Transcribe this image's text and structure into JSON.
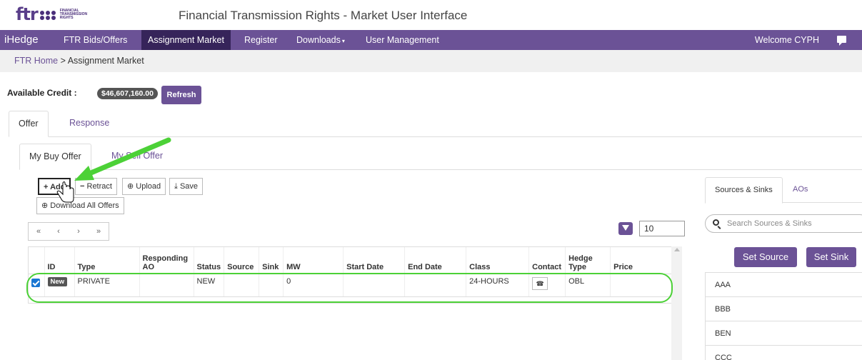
{
  "brand": {
    "logo_text": "ftr",
    "logo_sub": "FINANCIAL TRANSMISSION RIGHTS"
  },
  "app_title": "Financial Transmission Rights - Market User Interface",
  "nav": {
    "brand": "iHedge",
    "items": [
      "FTR Bids/Offers",
      "Assignment Market",
      "Register",
      "Downloads",
      "User Management"
    ],
    "welcome": "Welcome CYPH"
  },
  "breadcrumb": {
    "home": "FTR Home",
    "separator": " > ",
    "current": "Assignment Market"
  },
  "credit": {
    "label": "Available Credit :",
    "value": "$46,607,160.00",
    "refresh": "Refresh"
  },
  "tabs": [
    "Offer",
    "Response"
  ],
  "subtabs": [
    "My Buy Offer",
    "My Sell Offer"
  ],
  "toolbar": {
    "add": "Add",
    "retract": "Retract",
    "upload": "Upload",
    "save": "Save",
    "download_all": "Download All Offers"
  },
  "pager": {
    "first": "«",
    "prev": "‹",
    "next": "›",
    "last": "»"
  },
  "page_size": "10",
  "table": {
    "headers": [
      "ID",
      "Type",
      "Responding AO",
      "Status",
      "Source",
      "Sink",
      "MW",
      "Start Date",
      "End Date",
      "Class",
      "Contact",
      "Hedge Type",
      "Price"
    ],
    "rows": [
      {
        "id": "New",
        "type": "PRIVATE",
        "responding_ao": "",
        "status": "NEW",
        "source": "",
        "sink": "",
        "mw": "0",
        "start": "",
        "end": "",
        "class": "24-HOURS",
        "hedge_type": "OBL",
        "price": ""
      }
    ]
  },
  "right_panel": {
    "tabs": [
      "Sources & Sinks",
      "AOs"
    ],
    "search_placeholder": "Search Sources & Sinks",
    "set_source": "Set Source",
    "set_sink": "Set Sink",
    "nodes": [
      "AAA",
      "BBB",
      "BEN",
      "CCC"
    ]
  },
  "colors": {
    "accent": "#6b5296",
    "nav_active": "#36245a",
    "highlight": "#4cd137"
  },
  "icons": {
    "add": "plus-icon",
    "retract": "minus-icon",
    "upload": "upload-icon",
    "save": "save-icon",
    "contact": "contact-icon",
    "search": "search-icon",
    "filter": "filter-icon"
  }
}
